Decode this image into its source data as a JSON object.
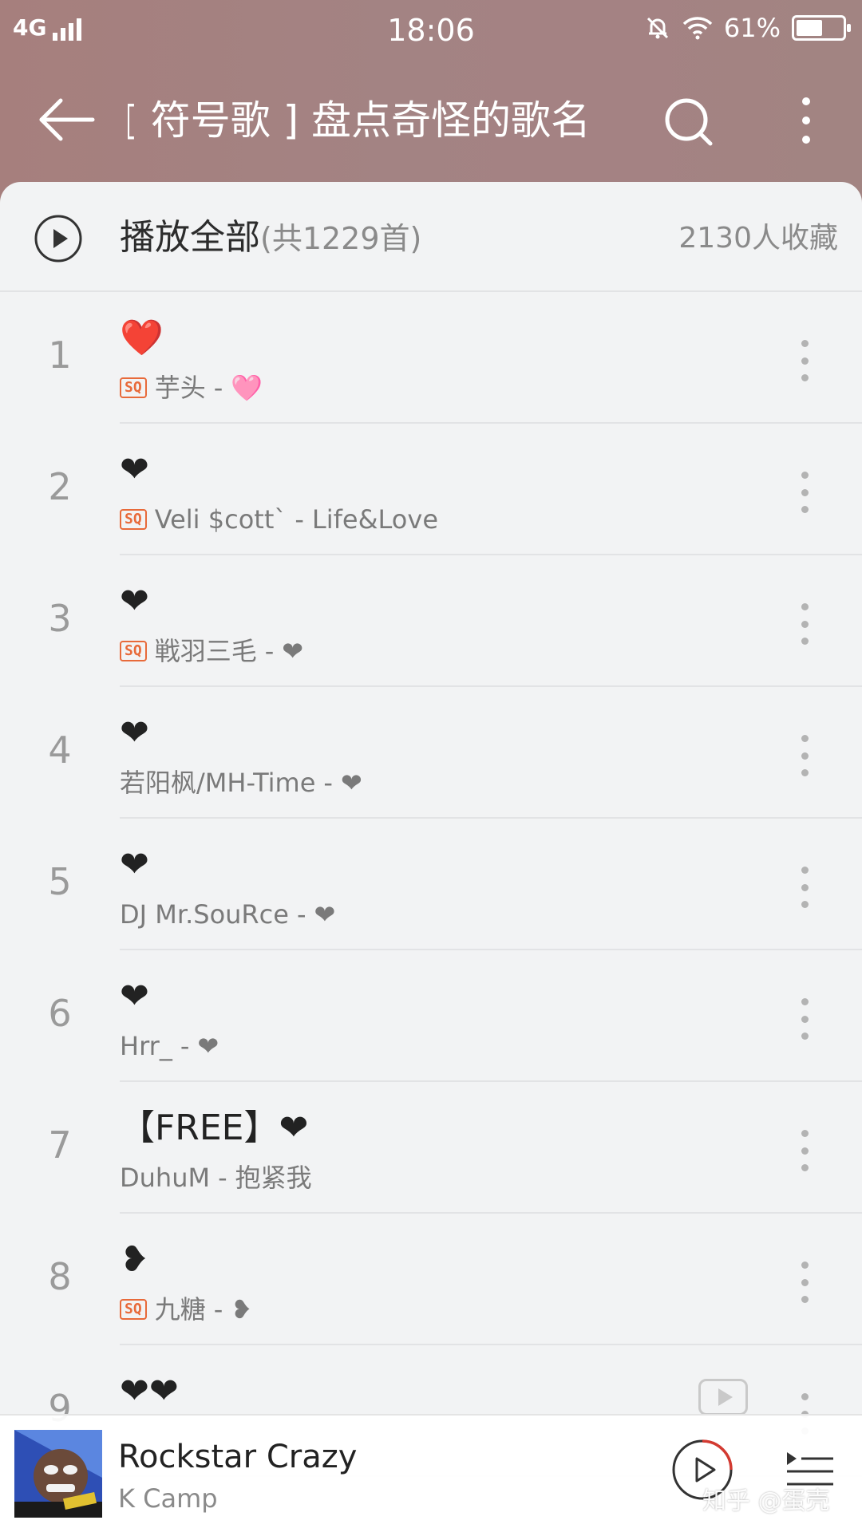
{
  "status_bar": {
    "network": "4G",
    "time": "18:06",
    "battery": "61%",
    "battery_level": 0.61
  },
  "toolbar": {
    "title": "[ 符号歌 ] 盘点奇怪的歌名"
  },
  "playlist": {
    "play_all_label": "播放全部",
    "track_count": "(共1229首)",
    "collect_count": "2130人收藏"
  },
  "songs": [
    {
      "index": "1",
      "title": "❤️",
      "sq": true,
      "artist": "芋头",
      "album": "🩷"
    },
    {
      "index": "2",
      "title": "❤",
      "sq": true,
      "artist": "Veli $cott`",
      "album": "Life&Love"
    },
    {
      "index": "3",
      "title": "❤",
      "sq": true,
      "artist": "戦羽三毛",
      "album": "❤"
    },
    {
      "index": "4",
      "title": "❤",
      "sq": false,
      "artist": "若阳枫/MH-Time",
      "album": "❤"
    },
    {
      "index": "5",
      "title": "❤",
      "sq": false,
      "artist": "DJ Mr.SouRce",
      "album": "❤"
    },
    {
      "index": "6",
      "title": "❤",
      "sq": false,
      "artist": "Hrr_",
      "album": "❤"
    },
    {
      "index": "7",
      "title": "【FREE】❤",
      "sq": false,
      "artist": "DuhuM",
      "album": "抱紧我"
    },
    {
      "index": "8",
      "title": "❥",
      "sq": true,
      "artist": "九糖",
      "album": "❥"
    },
    {
      "index": "9",
      "title": "❤❤",
      "sq": false,
      "artist": "",
      "album": ""
    }
  ],
  "now_playing": {
    "title": "Rockstar Crazy",
    "artist": "K Camp"
  },
  "watermark": "知乎 @蛋壳",
  "colors": {
    "header": "#a5807f",
    "background": "#f2f3f4",
    "sq_badge": "#e86a3a",
    "progress_ring": "#d33a31"
  },
  "icons": {
    "back": "arrow-left",
    "search": "magnifier",
    "more": "vertical-dots",
    "play_all": "play-circle",
    "playlist": "queue-list"
  }
}
